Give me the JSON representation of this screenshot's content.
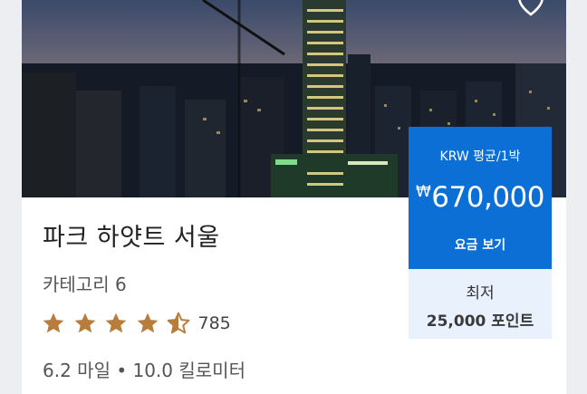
{
  "hotel": {
    "name": "파크 하얏트 서울",
    "category": "카테고리 6",
    "rating_stars": 4.5,
    "review_count": "785",
    "distance": "6.2 마일 • 10.0 킬로미터"
  },
  "price": {
    "unit_label": "KRW 평균/1박",
    "currency_symbol": "₩",
    "amount": "670,000",
    "cta_label": "요금 보기"
  },
  "points": {
    "label": "최저",
    "value": "25,000 포인트"
  },
  "colors": {
    "price_box": "#0c6fd6",
    "points_box": "#e9f2fc",
    "star": "#b87d3b"
  },
  "icons": {
    "favorite": "heart-outline-icon",
    "star_full": "star-icon",
    "star_half": "star-half-icon"
  }
}
